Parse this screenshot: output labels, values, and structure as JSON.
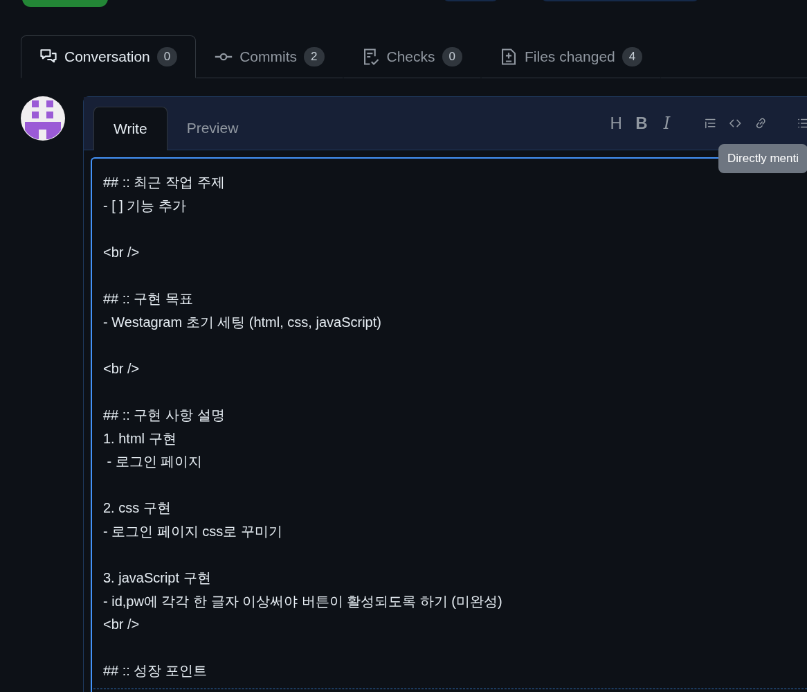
{
  "tabs": [
    {
      "kind": "conversation",
      "label": "Conversation",
      "count": "0",
      "selected": true
    },
    {
      "kind": "commits",
      "label": "Commits",
      "count": "2",
      "selected": false
    },
    {
      "kind": "checks",
      "label": "Checks",
      "count": "0",
      "selected": false
    },
    {
      "kind": "files",
      "label": "Files changed",
      "count": "4",
      "selected": false
    }
  ],
  "editor": {
    "tabs": [
      {
        "label": "Write",
        "selected": true
      },
      {
        "label": "Preview",
        "selected": false
      }
    ],
    "toolbar": [
      {
        "kind": "heading",
        "label": "H"
      },
      {
        "kind": "bold",
        "label": "B"
      },
      {
        "kind": "italic",
        "label": "I"
      },
      {
        "kind": "quote"
      },
      {
        "kind": "code"
      },
      {
        "kind": "link"
      },
      {
        "kind": "list"
      }
    ],
    "tooltip": "Directly menti",
    "value": "## :: 최근 작업 주제\n- [ ] 기능 추가\n\n<br />\n\n## :: 구현 목표\n- Westagram 초기 세팅 (html, css, javaScript)\n\n<br />\n\n## :: 구현 사항 설명\n1. html 구현\n - 로그인 페이지\n\n2. css 구현\n- 로그인 페이지 css로 꾸미기\n\n3. javaScript 구현\n- id,pw에 각각 한 글자 이상써야 버튼이 활성되도록 하기 (미완성)\n<br />\n\n## :: 성장 포인트"
  }
}
